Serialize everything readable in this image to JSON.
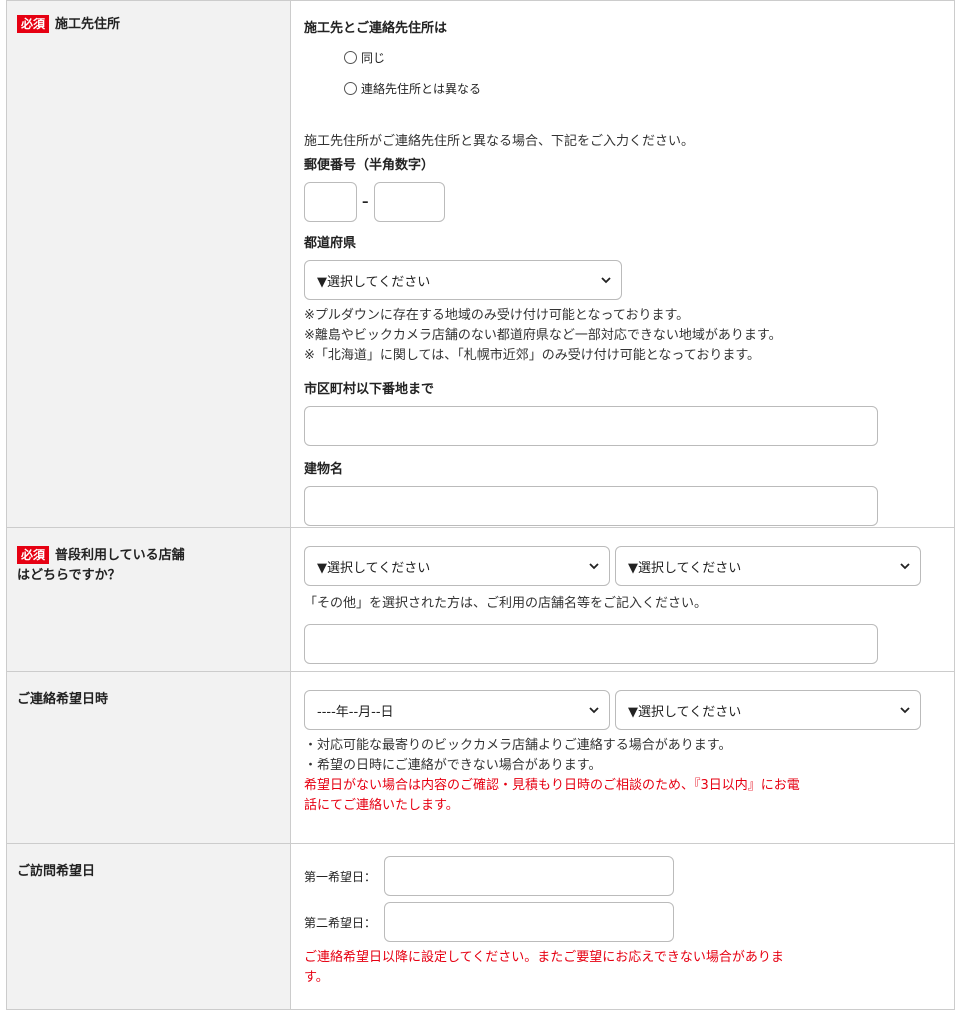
{
  "badge": "必須",
  "address": {
    "label": "施工先住所",
    "question": "施工先とご連絡先住所は",
    "options": [
      "同じ",
      "連絡先住所とは異なる"
    ],
    "instruction": "施工先住所がご連絡先住所と異なる場合、下記をご入力ください。",
    "zip_label": "郵便番号（半角数字）",
    "zip_dash": "–",
    "pref_label": "都道府県",
    "pref_select": "▼選択してください",
    "notes": [
      "※プルダウンに存在する地域のみ受け付け可能となっております。",
      "※離島やビックカメラ店舗のない都道府県など一部対応できない地域があります。",
      "※「北海道」に関しては、「札幌市近郊」のみ受け付け可能となっております。"
    ],
    "city_label": "市区町村以下番地まで",
    "building_label": "建物名"
  },
  "store": {
    "label_line1": "普段利用している店舗",
    "label_line2": "はどちらですか？",
    "select1": "▼選択してください",
    "select2": "▼選択してください",
    "note": "「その他」を選択された方は、ご利用の店舗名等をご記入ください。"
  },
  "contact": {
    "label": "ご連絡希望日時",
    "date_select": "----年--月--日",
    "time_select": "▼選択してください",
    "notes": [
      "・対応可能な最寄りのビックカメラ店舗よりご連絡する場合があります。",
      "・希望の日時にご連絡ができない場合があります。"
    ],
    "red_note_1": "希望日がない場合は内容のご確認・見積もり日時のご相談のため、『3日以内』にお電",
    "red_note_2": "話にてご連絡いたします。"
  },
  "visit": {
    "label": "ご訪問希望日",
    "first_label": "第一希望日：",
    "second_label": "第二希望日：",
    "red_note_1": "ご連絡希望日以降に設定してください。またご要望にお応えできない場合がありま",
    "red_note_2": "す。"
  },
  "colors": {
    "accent_red": "#e60012",
    "label_bg": "#f2f2f2"
  },
  "icons": {
    "select_arrow": "chevron-down-icon"
  }
}
